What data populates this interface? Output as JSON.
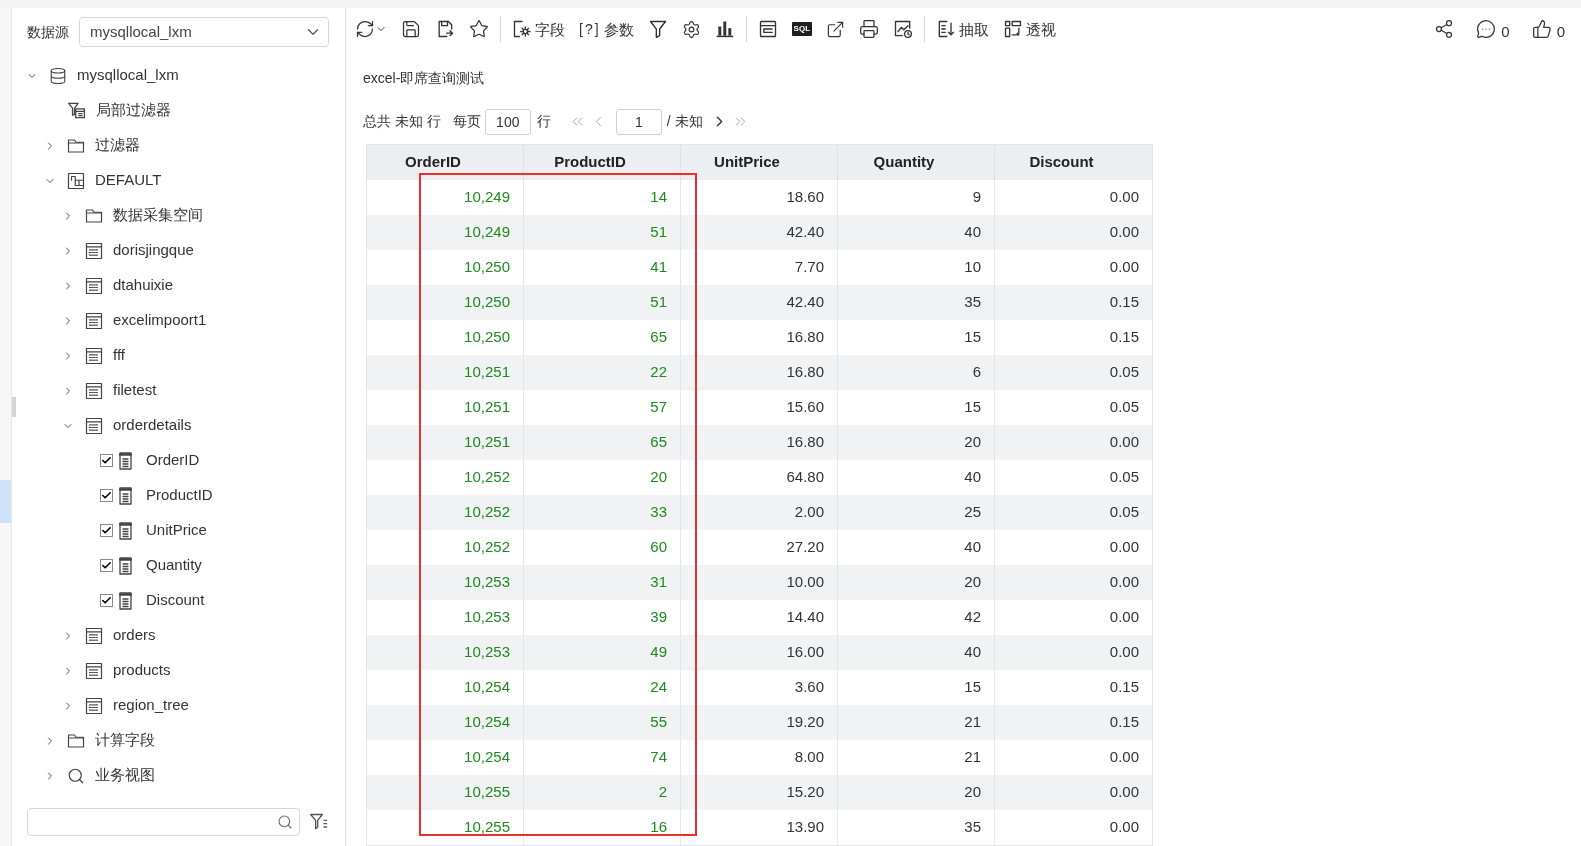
{
  "sidebar": {
    "datasource": {
      "label": "数据源",
      "value": "mysqllocal_lxm"
    },
    "tree": [
      {
        "label": "mysqllocal_lxm",
        "kind": "database",
        "expanded": true,
        "children": [
          {
            "label": "局部过滤器",
            "kind": "local-filter"
          },
          {
            "label": "过滤器",
            "kind": "folder",
            "expanded": false
          },
          {
            "label": "DEFAULT",
            "kind": "schema",
            "expanded": true,
            "children": [
              {
                "label": "数据采集空间",
                "kind": "folder",
                "expanded": false
              },
              {
                "label": "dorisjingque",
                "kind": "table",
                "expanded": false
              },
              {
                "label": "dtahuixie",
                "kind": "table",
                "expanded": false
              },
              {
                "label": "excelimpoort1",
                "kind": "table",
                "expanded": false
              },
              {
                "label": "fff",
                "kind": "table",
                "expanded": false
              },
              {
                "label": "filetest",
                "kind": "table",
                "expanded": false
              },
              {
                "label": "orderdetails",
                "kind": "table",
                "expanded": true,
                "children": [
                  {
                    "label": "OrderID",
                    "kind": "field",
                    "checked": true
                  },
                  {
                    "label": "ProductID",
                    "kind": "field",
                    "checked": true
                  },
                  {
                    "label": "UnitPrice",
                    "kind": "field",
                    "checked": true
                  },
                  {
                    "label": "Quantity",
                    "kind": "field",
                    "checked": true
                  },
                  {
                    "label": "Discount",
                    "kind": "field",
                    "checked": true
                  }
                ]
              },
              {
                "label": "orders",
                "kind": "table",
                "expanded": false
              },
              {
                "label": "products",
                "kind": "table",
                "expanded": false
              },
              {
                "label": "region_tree",
                "kind": "table",
                "expanded": false
              }
            ]
          },
          {
            "label": "计算字段",
            "kind": "folder",
            "expanded": false
          },
          {
            "label": "业务视图",
            "kind": "view",
            "expanded": false
          }
        ]
      }
    ]
  },
  "toolbar": [
    {
      "kind": "refresh"
    },
    {
      "kind": "save"
    },
    {
      "kind": "save-as"
    },
    {
      "kind": "favorite"
    },
    {
      "kind": "separator"
    },
    {
      "kind": "fields",
      "label": "字段"
    },
    {
      "kind": "parameters",
      "glyph": "[?]",
      "label": "参数"
    },
    {
      "kind": "filter"
    },
    {
      "kind": "settings"
    },
    {
      "kind": "chart"
    },
    {
      "kind": "separator"
    },
    {
      "kind": "layout"
    },
    {
      "kind": "sql",
      "glyph": "SQL"
    },
    {
      "kind": "export"
    },
    {
      "kind": "print"
    },
    {
      "kind": "schedule"
    },
    {
      "kind": "separator"
    },
    {
      "kind": "extract",
      "label": "抽取"
    },
    {
      "kind": "pivot",
      "label": "透视"
    }
  ],
  "toolbar_right": [
    {
      "kind": "share"
    },
    {
      "kind": "comment",
      "count": "0"
    },
    {
      "kind": "like",
      "count": "0"
    }
  ],
  "report_title": "excel-即席查询测试",
  "pagination": {
    "total": "总共 未知 行",
    "per_page_label": "每页",
    "per_page": "100",
    "per_page_unit": "行",
    "page": "1",
    "page_count": "/ 未知",
    "nav": [
      {
        "kind": "first",
        "disabled": true
      },
      {
        "kind": "prev",
        "disabled": true
      },
      {
        "kind": "next",
        "disabled": false
      },
      {
        "kind": "last",
        "disabled": true
      }
    ]
  },
  "table": {
    "columns": [
      {
        "label": "OrderID",
        "highlighted": true,
        "color": "#1e8a1e"
      },
      {
        "label": "ProductID",
        "highlighted": true,
        "color": "#1e8a1e"
      },
      {
        "label": "UnitPrice",
        "highlighted": false,
        "color": "#333333"
      },
      {
        "label": "Quantity",
        "highlighted": false,
        "color": "#333333"
      },
      {
        "label": "Discount",
        "highlighted": false,
        "color": "#333333"
      }
    ],
    "rows": [
      [
        "10,249",
        "14",
        "18.60",
        "9",
        "0.00"
      ],
      [
        "10,249",
        "51",
        "42.40",
        "40",
        "0.00"
      ],
      [
        "10,250",
        "41",
        "7.70",
        "10",
        "0.00"
      ],
      [
        "10,250",
        "51",
        "42.40",
        "35",
        "0.15"
      ],
      [
        "10,250",
        "65",
        "16.80",
        "15",
        "0.15"
      ],
      [
        "10,251",
        "22",
        "16.80",
        "6",
        "0.05"
      ],
      [
        "10,251",
        "57",
        "15.60",
        "15",
        "0.05"
      ],
      [
        "10,251",
        "65",
        "16.80",
        "20",
        "0.00"
      ],
      [
        "10,252",
        "20",
        "64.80",
        "40",
        "0.05"
      ],
      [
        "10,252",
        "33",
        "2.00",
        "25",
        "0.05"
      ],
      [
        "10,252",
        "60",
        "27.20",
        "40",
        "0.00"
      ],
      [
        "10,253",
        "31",
        "10.00",
        "20",
        "0.00"
      ],
      [
        "10,253",
        "39",
        "14.40",
        "42",
        "0.00"
      ],
      [
        "10,253",
        "49",
        "16.00",
        "40",
        "0.00"
      ],
      [
        "10,254",
        "24",
        "3.60",
        "15",
        "0.15"
      ],
      [
        "10,254",
        "55",
        "19.20",
        "21",
        "0.15"
      ],
      [
        "10,254",
        "74",
        "8.00",
        "21",
        "0.00"
      ],
      [
        "10,255",
        "2",
        "15.20",
        "20",
        "0.00"
      ],
      [
        "10,255",
        "16",
        "13.90",
        "35",
        "0.00"
      ]
    ]
  }
}
